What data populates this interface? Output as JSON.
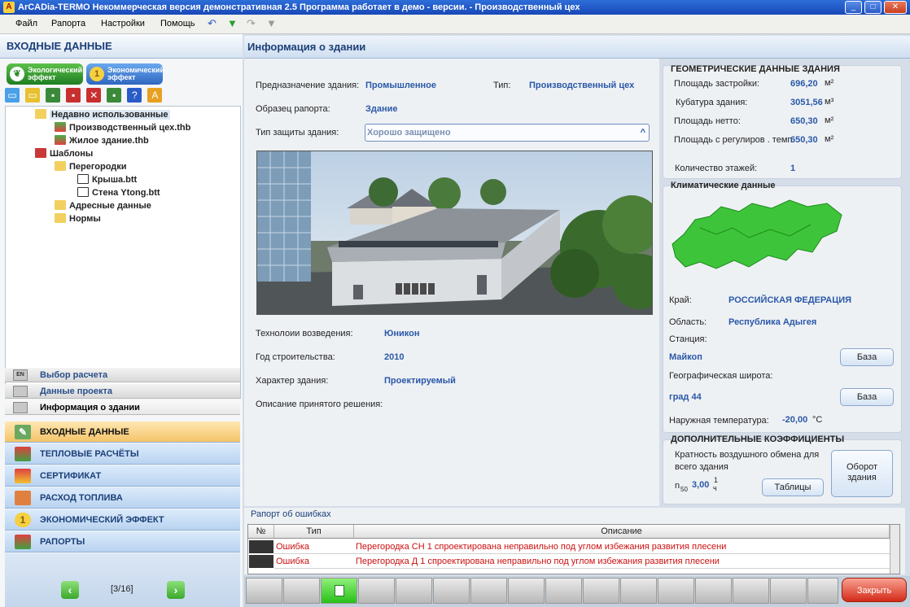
{
  "window": {
    "title": "ArCADia-TERMO Некоммерческая версия демонстративная 2.5 Программа работает в демо - версии. - Производственный цех"
  },
  "menu": {
    "items": [
      "Файл",
      "Рапорта",
      "Настройки",
      "Помощь"
    ]
  },
  "left": {
    "header": "ВХОДНЫЕ ДАННЫЕ",
    "eco_button": "Экологический эффект",
    "econ_button": "Экономический эффект",
    "tree": [
      {
        "label": "Недавно использованные"
      },
      {
        "label": "Производственный цех.thb"
      },
      {
        "label": "Жилое здание.thb"
      },
      {
        "label": "Шаблоны"
      },
      {
        "label": "Перегородки"
      },
      {
        "label": "Крыша.btt"
      },
      {
        "label": "Стена Ytong.btt"
      },
      {
        "label": "Адресные данные"
      },
      {
        "label": "Нормы"
      }
    ],
    "subnav": [
      "Выбор расчета",
      "Данные проекта",
      "Информация о здании"
    ],
    "nav": [
      "ВХОДНЫЕ ДАННЫЕ",
      "ТЕПЛОВЫЕ РАСЧЁТЫ",
      "СЕРТИФИКАТ",
      "РАСХОД ТОПЛИВА",
      "ЭКОНОМИЧЕСКИЙ ЭФФЕКТ",
      "РАПОРТЫ"
    ],
    "pager": "[3/16]"
  },
  "main": {
    "header": "Информация о здании",
    "purpose_label": "Предназначение здания:",
    "purpose_value": "Промышленное",
    "type_label": "Тип:",
    "type_value": "Производственный цех",
    "template_label": "Образец рапорта:",
    "template_value": "Здание",
    "protection_label": "Тип защиты здания:",
    "protection_value": "Хорошо защищено",
    "tech_label": "Технолоии возведения:",
    "tech_value": "Юникон",
    "year_label": "Год строительства:",
    "year_value": "2010",
    "character_label": "Характер здания:",
    "character_value": "Проектируемый",
    "description_label": "Описание принятого решения:"
  },
  "geometry": {
    "title": "ГЕОМЕТРИЧЕСКИЕ ДАННЫЕ ЗДАНИЯ",
    "area_label": "Площадь застройки:",
    "area_value": "696,20",
    "area_unit": "м²",
    "volume_label": "Кубатура здания:",
    "volume_value": "3051,56",
    "volume_unit": "м³",
    "net_label": "Площадь нетто:",
    "net_value": "650,30",
    "net_unit": "м²",
    "heated_label": "Площадь с регулиров . темп",
    "heated_value": "650,30",
    "heated_unit": "м²",
    "floors_label": "Количество этажей:",
    "floors_value": "1"
  },
  "climate": {
    "title": "Климатические данные",
    "region_label": "Край:",
    "region_value": "РОССИЙСКАЯ ФЕДЕРАЦИЯ",
    "oblast_label": "Область:",
    "oblast_value": "Республика Адыгея",
    "station_label": "Станция:",
    "station_value": "Майкоп",
    "base_button": "База",
    "latitude_label": "Географическая широта:",
    "latitude_value": "град 44",
    "base_button2": "База",
    "temp_label": "Наружная температура:",
    "temp_value": "-20,00",
    "temp_unit": "°С"
  },
  "coeffs": {
    "title": "ДОПОЛНИТЕЛЬНЫЕ КОЭФФИЦИЕНТЫ",
    "air_label_1": "Кратность воздушного обмена для",
    "air_label_2": "всего здания",
    "n50_label": "n",
    "n50_sub": "50",
    "n50_value": "3,00",
    "n50_unit_num": "1",
    "n50_unit_den": "ч",
    "tables_button": "Таблицы",
    "rotate_button_1": "Оборот",
    "rotate_button_2": "здания"
  },
  "errors": {
    "title": "Рапорт об ошибках",
    "columns": [
      "№",
      "Тип",
      "Описание"
    ],
    "rows": [
      {
        "type": "Ошибка",
        "desc": "Перегородка СН 1 спроектирована неправильно под углом избежания развития плесени"
      },
      {
        "type": "Ошибка",
        "desc": "Перегородка Д 1 спроектирована неправильно под углом избежания развития плесени"
      }
    ]
  },
  "bottom": {
    "close_button": "Закрыть"
  }
}
